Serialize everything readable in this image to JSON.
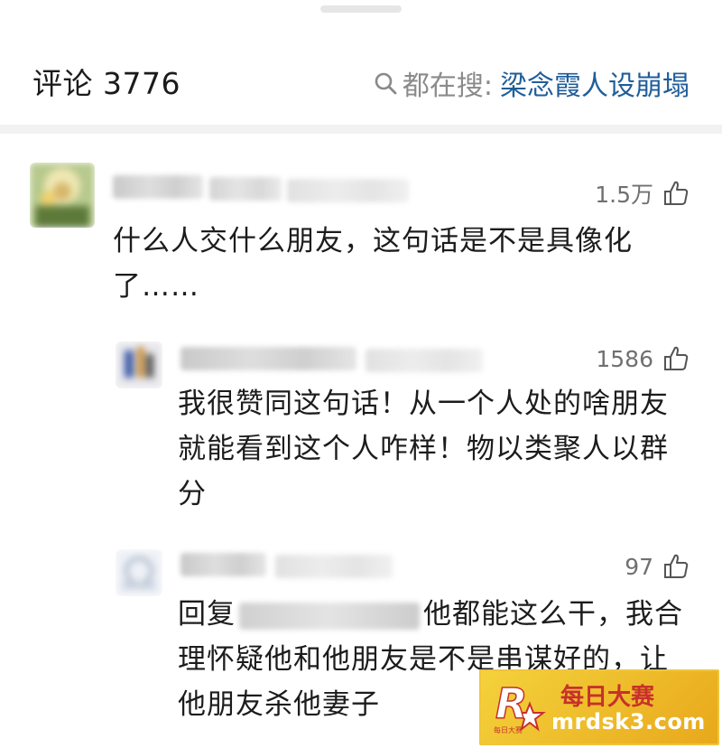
{
  "header": {
    "comment_count_label": "评论 3776",
    "trending_label": "都在搜:",
    "trending_term": "梁念霞人设崩塌"
  },
  "comments": [
    {
      "likes": "1.5万",
      "text_line1": "什么人交什么朋友，这句话是不是具像化",
      "text_line2": "了……"
    },
    {
      "likes": "1586",
      "text_line1": "我很赞同这句话！从一个人处的啥朋友",
      "text_line2": "就能看到这个人咋样！物以类聚人以群",
      "text_line3": "分"
    },
    {
      "likes": "97",
      "reply_prefix": "回复",
      "text_line1_suffix": "他都能这么干，我合",
      "text_line2": "理怀疑他和他朋友是不是串谋好的，让",
      "text_line3": "他朋友杀他妻子"
    }
  ],
  "watermark": {
    "logo_letter": "R",
    "logo_subtext": "每日大赛",
    "site_name": "每日大赛",
    "domain": "mrdsk3.com"
  },
  "colors": {
    "trending_term": "#1f5d99",
    "watermark_bg": "#f4d23c",
    "watermark_text": "#c8302c"
  },
  "icons": [
    "search-icon",
    "thumbs-up-icon"
  ]
}
